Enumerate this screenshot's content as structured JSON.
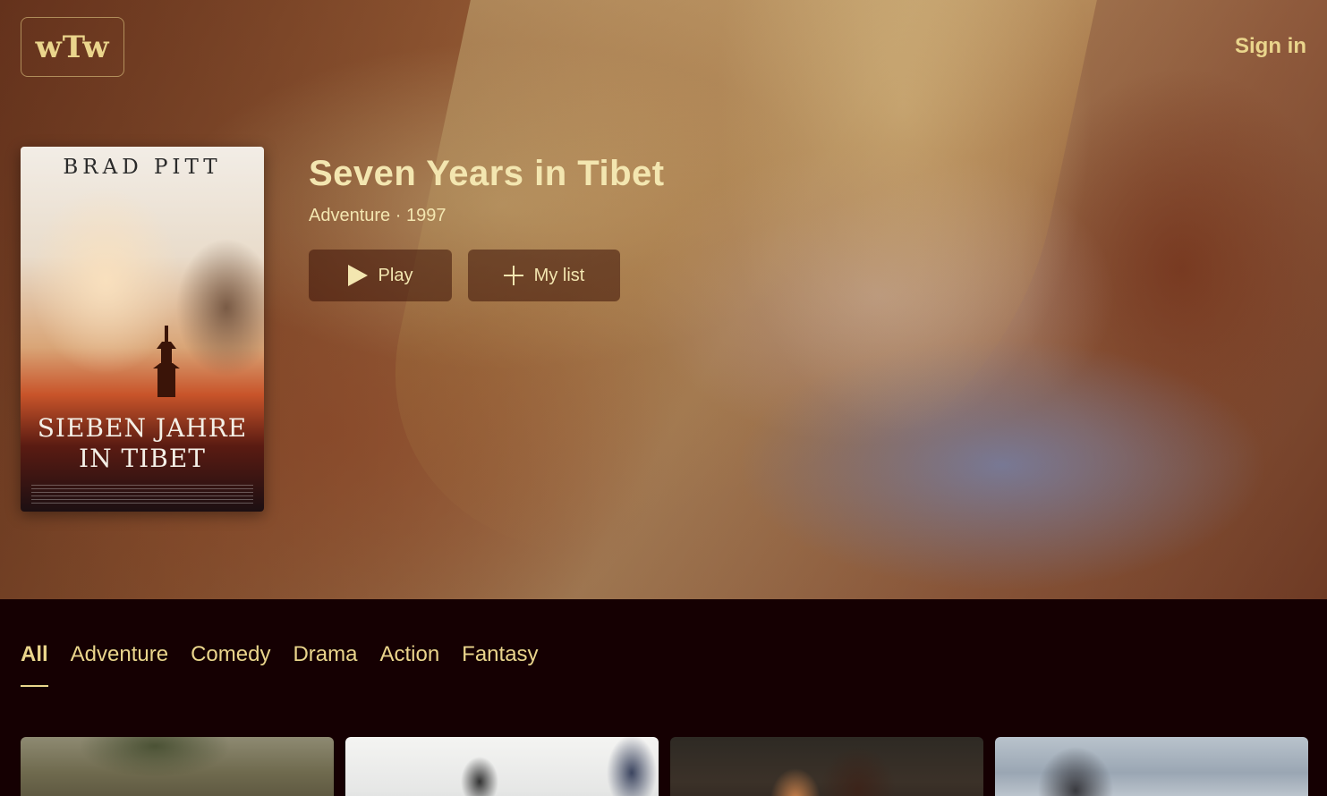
{
  "header": {
    "logo_text": "wTw",
    "signin_label": "Sign in"
  },
  "featured": {
    "poster": {
      "top_text": "BRAD PITT",
      "title_line1": "SIEBEN JAHRE",
      "title_line2": "IN TIBET"
    },
    "title": "Seven Years in Tibet",
    "meta": "Adventure · 1997",
    "play_label": "Play",
    "mylist_label": "My list"
  },
  "genres": {
    "tabs": [
      {
        "label": "All",
        "active": true
      },
      {
        "label": "Adventure",
        "active": false
      },
      {
        "label": "Comedy",
        "active": false
      },
      {
        "label": "Drama",
        "active": false
      },
      {
        "label": "Action",
        "active": false
      },
      {
        "label": "Fantasy",
        "active": false
      }
    ]
  },
  "colors": {
    "background": "#150002",
    "accent": "#ead58c",
    "title": "#f3e6b0"
  },
  "icons": {
    "play": "play-icon",
    "add": "plus-icon"
  }
}
